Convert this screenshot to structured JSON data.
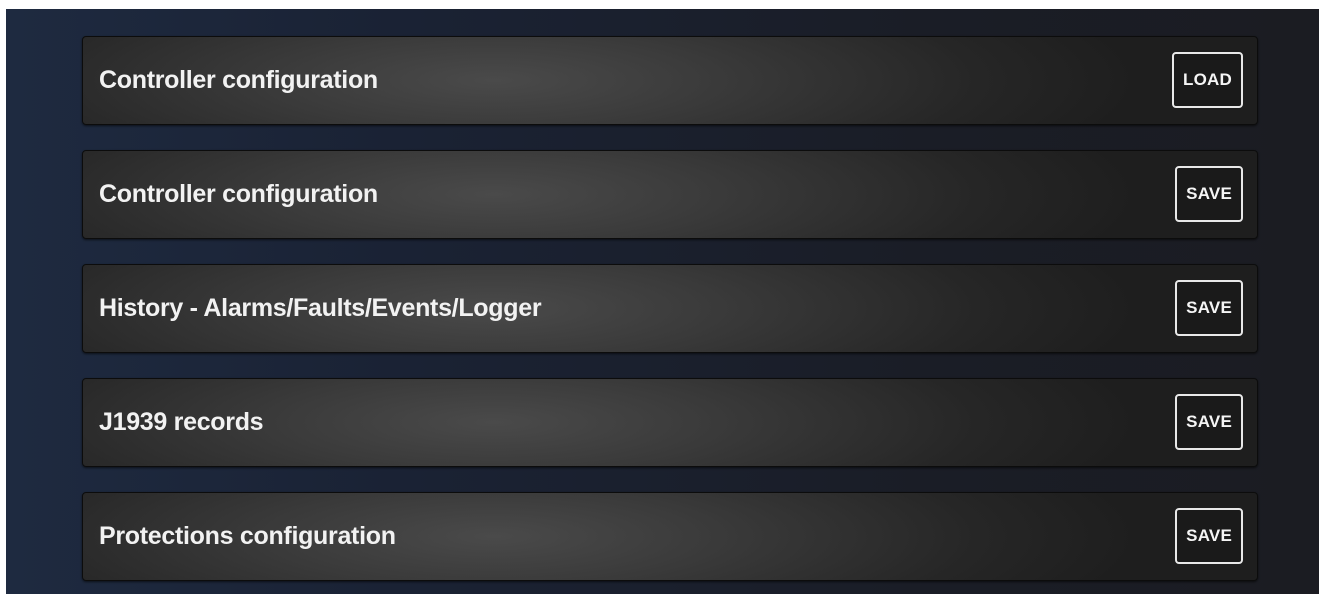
{
  "rows": [
    {
      "label": "Controller configuration",
      "button": "LOAD"
    },
    {
      "label": "Controller configuration",
      "button": "SAVE"
    },
    {
      "label": "History - Alarms/Faults/Events/Logger",
      "button": "SAVE"
    },
    {
      "label": "J1939 records",
      "button": "SAVE"
    },
    {
      "label": "Protections configuration",
      "button": "SAVE"
    }
  ]
}
